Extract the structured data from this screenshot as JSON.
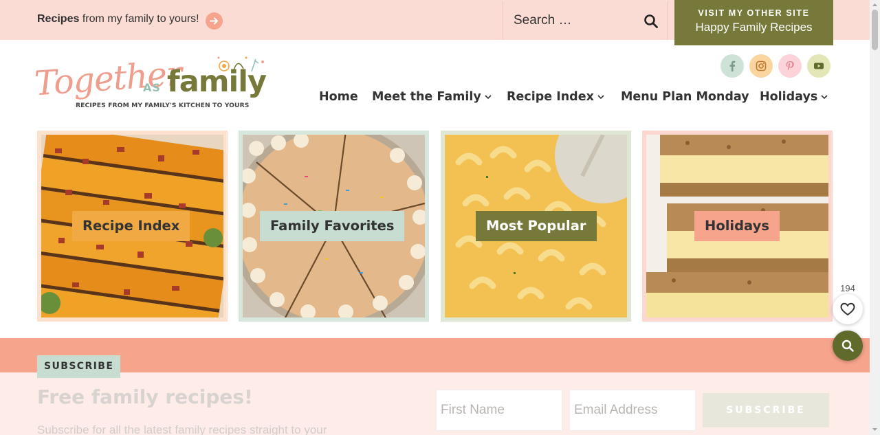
{
  "topbar": {
    "tagline_bold": "Recipes",
    "tagline_rest": " from my family to yours!",
    "search_placeholder": "Search …",
    "other_site_kicker": "VISIT MY OTHER SITE",
    "other_site_name": "Happy Family Recipes"
  },
  "logo": {
    "script": "Together",
    "as": "AS",
    "family": "family",
    "subtitle": "RECIPES FROM MY FAMILY'S KITCHEN TO YOURS"
  },
  "social": [
    "facebook-icon",
    "instagram-icon",
    "pinterest-icon",
    "youtube-icon"
  ],
  "nav": {
    "home": "Home",
    "meet": "Meet the Family",
    "recipe_index": "Recipe Index",
    "menu_plan": "Menu Plan Monday",
    "holidays": "Holidays"
  },
  "tiles": [
    {
      "label": "Recipe Index",
      "label_bg": "#f1a943",
      "frame": "#fde1cf"
    },
    {
      "label": "Family Favorites",
      "label_bg": "#c7ddd2",
      "frame": "#d7e7de"
    },
    {
      "label": "Most Popular",
      "label_bg": "#76793a",
      "frame": "#dfe6d3"
    },
    {
      "label": "Holidays",
      "label_bg": "#f6a48c",
      "frame": "#fbd7d0"
    }
  ],
  "subscribe": {
    "pill": "SUBSCRIBE",
    "title": "Free family recipes!",
    "text": "Subscribe for all the latest family recipes straight to your",
    "first_name_placeholder": "First Name",
    "email_placeholder": "Email Address",
    "button": "SUBSCRIBE"
  },
  "favorites": {
    "count": "194"
  },
  "colors": {
    "topbar_bg": "#fbdcd4",
    "accent_olive": "#76793a",
    "accent_peach": "#f6a48c"
  }
}
